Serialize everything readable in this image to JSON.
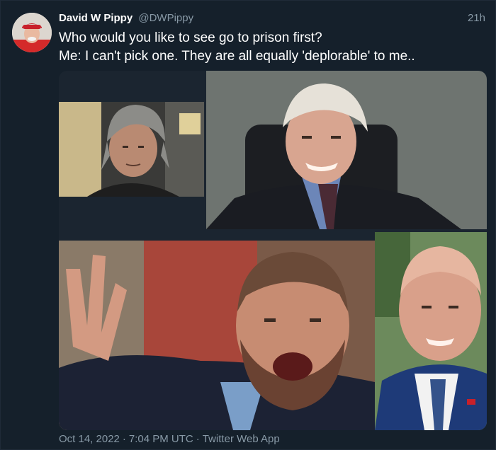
{
  "tweet": {
    "display_name": "David W Pippy",
    "handle": "@DWPippy",
    "relative_time": "21h",
    "text": "Who would you like to see go to prison first?\nMe: I can't pick one. They are all equally 'deplorable' to me..",
    "avatar_icon": "user-avatar-photo"
  },
  "media": {
    "count": 4,
    "tiles": [
      {
        "name": "photo-1",
        "desc_icon": "photo-man-gray-hair"
      },
      {
        "name": "photo-2",
        "desc_icon": "photo-man-white-hair-suit"
      },
      {
        "name": "photo-3",
        "desc_icon": "photo-man-beard-shouting"
      },
      {
        "name": "photo-4",
        "desc_icon": "photo-man-bald-suit"
      }
    ]
  },
  "footer": {
    "date": "Oct 14, 2022",
    "time": "7:04 PM UTC",
    "source": "Twitter Web App",
    "separator": "·"
  },
  "colors": {
    "background": "#15202b",
    "text_primary": "#ffffff",
    "text_secondary": "#8899a6"
  }
}
